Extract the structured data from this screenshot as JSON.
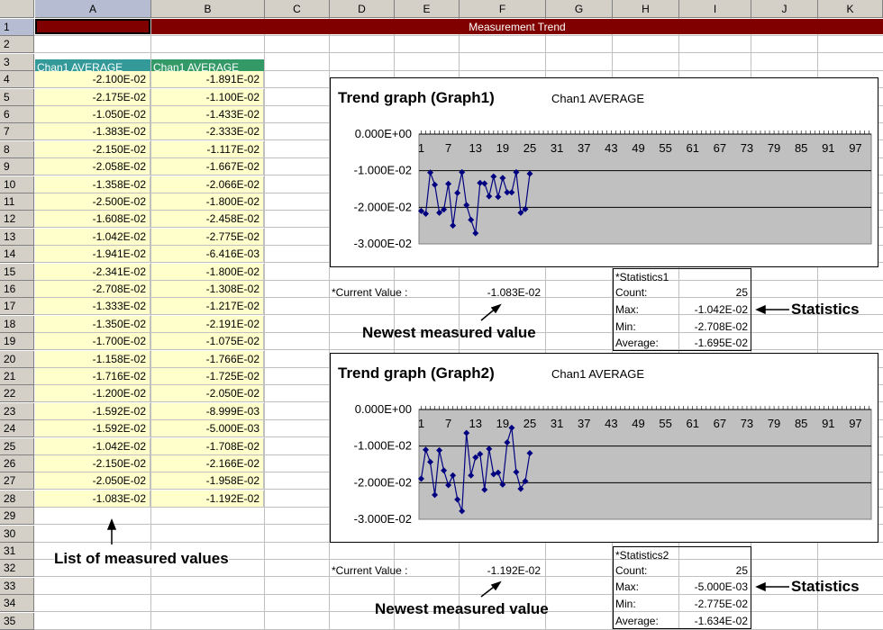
{
  "columns": [
    "A",
    "B",
    "C",
    "D",
    "E",
    "F",
    "G",
    "H",
    "I",
    "J",
    "K"
  ],
  "rows": [
    "1",
    "2",
    "3",
    "4",
    "5",
    "6",
    "7",
    "8",
    "9",
    "10",
    "11",
    "12",
    "13",
    "14",
    "15",
    "16",
    "17",
    "18",
    "19",
    "20",
    "21",
    "22",
    "23",
    "24",
    "25",
    "26",
    "27",
    "28",
    "29",
    "30",
    "31",
    "32",
    "33",
    "34",
    "35"
  ],
  "banner": "Measurement  Trend",
  "header_a": "Chan1 AVERAGE",
  "header_b": "Chan1 AVERAGE",
  "col_a": [
    "-2.100E-02",
    "-2.175E-02",
    "-1.050E-02",
    "-1.383E-02",
    "-2.150E-02",
    "-2.058E-02",
    "-1.358E-02",
    "-2.500E-02",
    "-1.608E-02",
    "-1.042E-02",
    "-1.941E-02",
    "-2.341E-02",
    "-2.708E-02",
    "-1.333E-02",
    "-1.350E-02",
    "-1.700E-02",
    "-1.158E-02",
    "-1.716E-02",
    "-1.200E-02",
    "-1.592E-02",
    "-1.592E-02",
    "-1.042E-02",
    "-2.150E-02",
    "-2.050E-02",
    "-1.083E-02"
  ],
  "col_b": [
    "-1.891E-02",
    "-1.100E-02",
    "-1.433E-02",
    "-2.333E-02",
    "-1.117E-02",
    "-1.667E-02",
    "-2.066E-02",
    "-1.800E-02",
    "-2.458E-02",
    "-2.775E-02",
    "-6.416E-03",
    "-1.800E-02",
    "-1.308E-02",
    "-1.217E-02",
    "-2.191E-02",
    "-1.075E-02",
    "-1.766E-02",
    "-1.725E-02",
    "-2.050E-02",
    "-8.999E-03",
    "-5.000E-03",
    "-1.708E-02",
    "-2.166E-02",
    "-1.958E-02",
    "-1.192E-02"
  ],
  "graph1": {
    "title": "Trend graph (Graph1)",
    "subtitle": "Chan1 AVERAGE",
    "current_label": "*Current Value :",
    "current_value": "-1.083E-02",
    "stats": {
      "heading": "*Statistics1",
      "count_label": "Count:",
      "count": "25",
      "max_label": "Max:",
      "max": "-1.042E-02",
      "min_label": "Min:",
      "min": "-2.708E-02",
      "avg_label": "Average:",
      "avg": "-1.695E-02"
    }
  },
  "graph2": {
    "title": "Trend graph (Graph2)",
    "subtitle": "Chan1 AVERAGE",
    "current_label": "*Current Value :",
    "current_value": "-1.192E-02",
    "stats": {
      "heading": "*Statistics2",
      "count_label": "Count:",
      "count": "25",
      "max_label": "Max:",
      "max": "-5.000E-03",
      "min_label": "Min:",
      "min": "-2.775E-02",
      "avg_label": "Average:",
      "avg": "-1.634E-02"
    }
  },
  "annotations": {
    "newest1": "Newest measured value",
    "newest2": "Newest measured value",
    "statistics1": "Statistics",
    "statistics2": "Statistics",
    "list": "List of measured values"
  },
  "chart_data": [
    {
      "type": "line",
      "x_ticks": [
        "1",
        "7",
        "13",
        "19",
        "25",
        "31",
        "37",
        "43",
        "49",
        "55",
        "61",
        "67",
        "73",
        "79",
        "85",
        "91",
        "97"
      ],
      "y_ticks": [
        "0.000E+00",
        "-1.000E-02",
        "-2.000E-02",
        "-3.000E-02"
      ],
      "ylim": [
        -0.03,
        0
      ],
      "x_max": 100,
      "series": [
        {
          "values": [
            -0.021,
            -0.02175,
            -0.0105,
            -0.01383,
            -0.0215,
            -0.02058,
            -0.01358,
            -0.025,
            -0.01608,
            -0.01042,
            -0.01941,
            -0.02341,
            -0.02708,
            -0.01333,
            -0.0135,
            -0.017,
            -0.01158,
            -0.01716,
            -0.012,
            -0.01592,
            -0.01592,
            -0.01042,
            -0.0215,
            -0.0205,
            -0.01083
          ]
        }
      ]
    },
    {
      "type": "line",
      "x_ticks": [
        "1",
        "7",
        "13",
        "19",
        "25",
        "31",
        "37",
        "43",
        "49",
        "55",
        "61",
        "67",
        "73",
        "79",
        "85",
        "91",
        "97"
      ],
      "y_ticks": [
        "0.000E+00",
        "-1.000E-02",
        "-2.000E-02",
        "-3.000E-02"
      ],
      "ylim": [
        -0.03,
        0
      ],
      "x_max": 100,
      "series": [
        {
          "values": [
            -0.01891,
            -0.011,
            -0.01433,
            -0.02333,
            -0.01117,
            -0.01667,
            -0.02066,
            -0.018,
            -0.02458,
            -0.02775,
            -0.006416,
            -0.018,
            -0.01308,
            -0.01217,
            -0.02191,
            -0.01075,
            -0.01766,
            -0.01725,
            -0.0205,
            -0.008999,
            -0.005,
            -0.01708,
            -0.02166,
            -0.01958,
            -0.01192
          ]
        }
      ]
    }
  ]
}
